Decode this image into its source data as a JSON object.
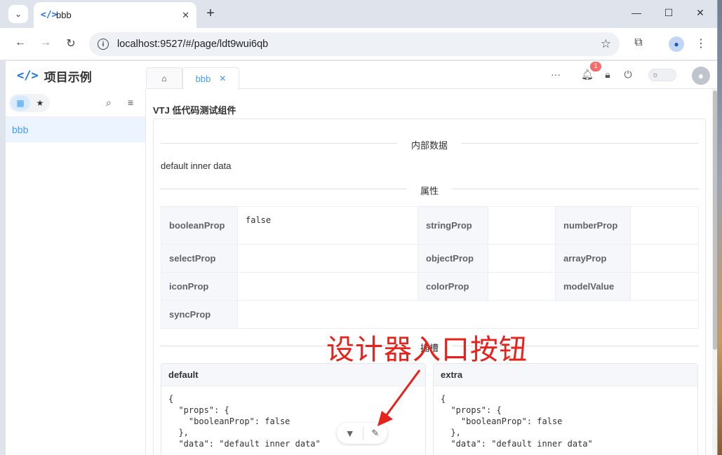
{
  "browser": {
    "tab_title": "bbb",
    "url": "localhost:9527/#/page/ldt9wui6qb",
    "favicon_icon": "code-brackets-icon"
  },
  "app": {
    "name": "项目示例",
    "home_tab_icon": "home-icon",
    "active_tab": "bbb",
    "notification_count": "1"
  },
  "sidebar": {
    "items": [
      {
        "label": "bbb"
      }
    ]
  },
  "main": {
    "heading": "VTJ 低代码测试组件",
    "section_inner": "内部数据",
    "inner_value": "default inner data",
    "section_props": "属性",
    "section_slots": "插槽",
    "props": {
      "booleanProp": "booleanProp",
      "booleanProp_value": "false",
      "stringProp": "stringProp",
      "numberProp": "numberProp",
      "selectProp": "selectProp",
      "objectProp": "objectProp",
      "arrayProp": "arrayProp",
      "iconProp": "iconProp",
      "colorProp": "colorProp",
      "modelValue": "modelValue",
      "syncProp": "syncProp"
    },
    "slots": [
      {
        "title": "default",
        "code": "{\n  \"props\": {\n    \"booleanProp\": false\n  },\n  \"data\": \"default inner data\""
      },
      {
        "title": "extra",
        "code": "{\n  \"props\": {\n    \"booleanProp\": false\n  },\n  \"data\": \"default inner data\""
      }
    ]
  },
  "annotation": {
    "text": "设计器入口按钮",
    "color": "#e8211b"
  },
  "colors": {
    "accent": "#409eff",
    "badge": "#f56c6c"
  }
}
